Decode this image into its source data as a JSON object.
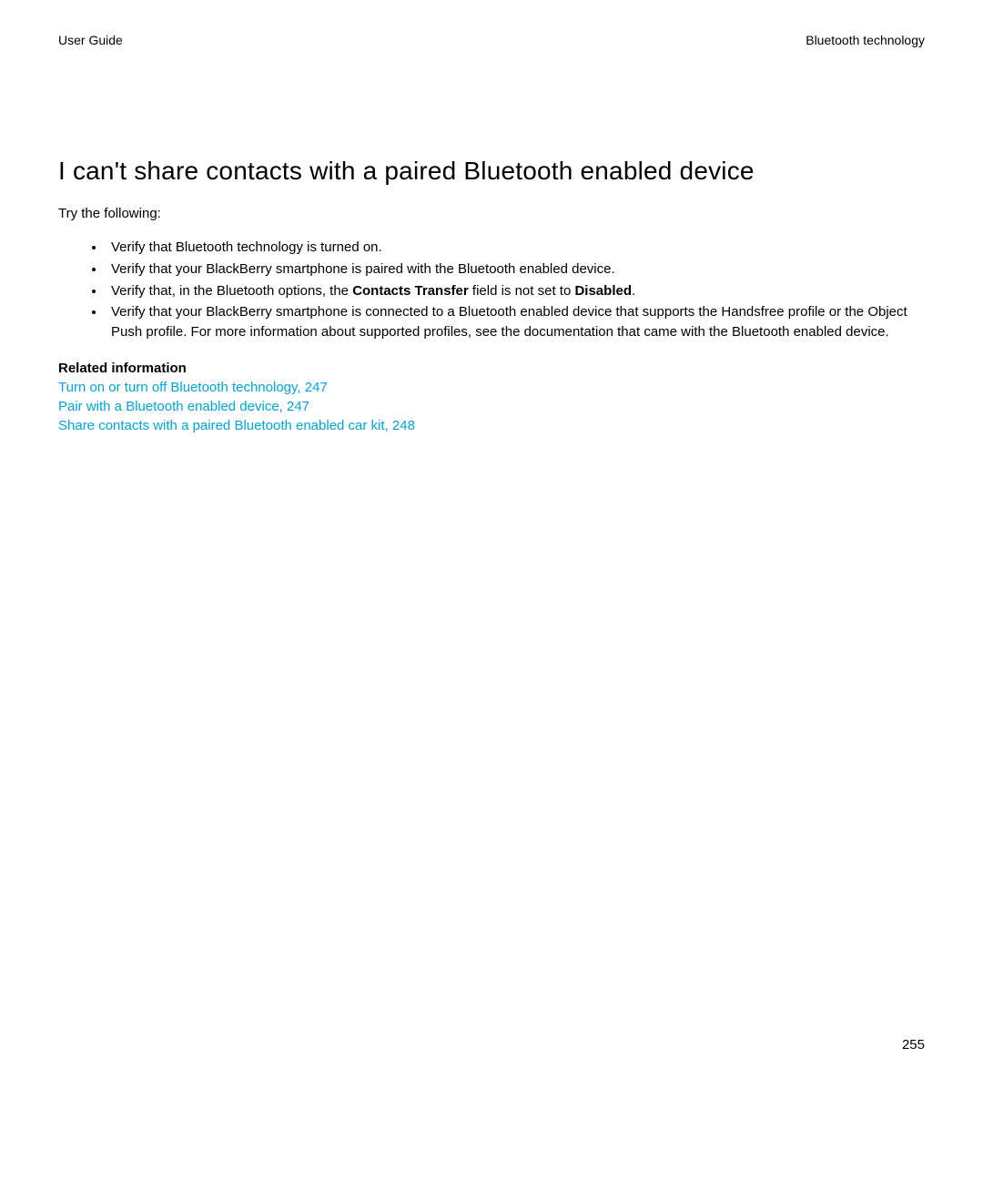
{
  "header": {
    "left": "User Guide",
    "right": "Bluetooth technology"
  },
  "title": "I can't share contacts with a paired Bluetooth enabled device",
  "intro": "Try the following:",
  "bullets": [
    {
      "type": "plain",
      "text": "Verify that Bluetooth technology is turned on."
    },
    {
      "type": "plain",
      "text": "Verify that your BlackBerry smartphone is paired with the Bluetooth enabled device."
    },
    {
      "type": "contacts_transfer",
      "pre": "Verify that, in the Bluetooth options, the ",
      "b1": "Contacts Transfer",
      "mid": " field is not set to ",
      "b2": "Disabled",
      "post": "."
    },
    {
      "type": "plain",
      "text": "Verify that your BlackBerry smartphone is connected to a Bluetooth enabled device that supports the Handsfree profile or the Object Push profile. For more information about supported profiles, see the documentation that came with the Bluetooth enabled device."
    }
  ],
  "related_heading": "Related information",
  "links": [
    "Turn on or turn off Bluetooth technology, 247",
    "Pair with a Bluetooth enabled device, 247",
    "Share contacts with a paired Bluetooth enabled car kit, 248"
  ],
  "page_number": "255"
}
